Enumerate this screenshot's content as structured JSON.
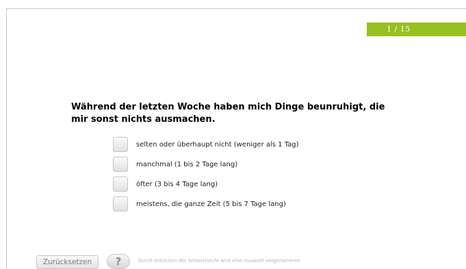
{
  "progress": {
    "text": "1 / 15",
    "current": 1,
    "total": 15
  },
  "question": {
    "text": "Während der letzten Woche haben mich Dinge beunruhigt, die mir sonst nichts ausmachen."
  },
  "options": [
    {
      "label": "selten oder überhaupt nicht (weniger als 1 Tag)",
      "checked": false
    },
    {
      "label": "manchmal (1 bis 2 Tage lang)",
      "checked": false
    },
    {
      "label": "öfter (3 bis 4 Tage lang)",
      "checked": false
    },
    {
      "label": "meistens, die ganze Zeit (5 bis 7 Tage lang)",
      "checked": false
    }
  ],
  "footer": {
    "reset_label": "Zurücksetzen",
    "help_label": "?",
    "hint": "Durch Anklicken der Antwortstufe wird eine Auswahl vorgenommen"
  },
  "colors": {
    "accent": "#97c11f"
  }
}
